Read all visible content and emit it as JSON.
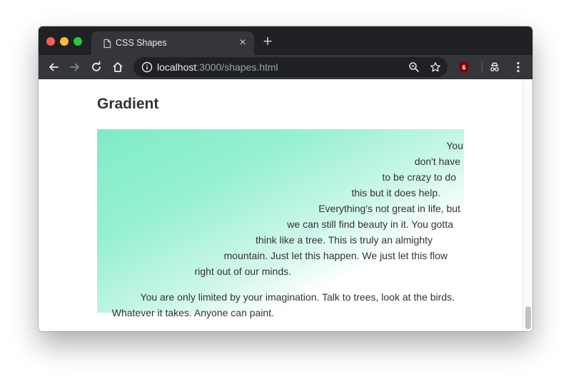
{
  "browser": {
    "tab_title": "CSS Shapes",
    "tab_close": "×",
    "new_tab": "+",
    "url_host": "localhost",
    "url_path": ":3000/shapes.html",
    "extension_badge": "6"
  },
  "page": {
    "heading": "Gradient",
    "shaped_lines": [
      "You",
      "don't have",
      "to be crazy to do",
      "this but it does help.",
      "Everything's not great in life, but",
      "we can still find beauty in it. You gotta",
      "think like a tree. This is truly an almighty",
      "mountain. Just let this happen. We just let this flow",
      "right out of our minds."
    ],
    "paragraph_lines": [
      "You are only limited by your imagination. Talk to trees, look at the birds.",
      "Whatever it takes. Anyone can paint."
    ]
  },
  "colors": {
    "gradient_start": "#7eecc6",
    "gradient_end": "#ffffff",
    "text": "#333333",
    "chrome_dark": "#202124",
    "chrome_tab": "#35363a"
  }
}
